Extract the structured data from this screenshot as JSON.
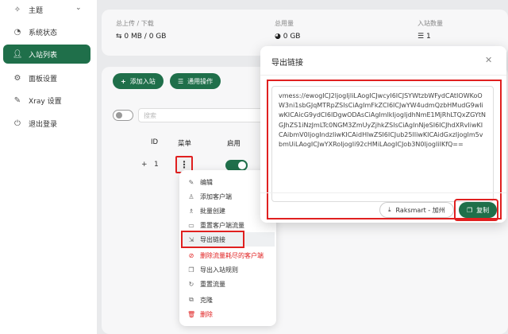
{
  "sidebar": {
    "items": [
      {
        "label": "主题",
        "icon": "bulb-icon"
      },
      {
        "label": "系统状态",
        "icon": "dashboard-icon"
      },
      {
        "label": "入站列表",
        "icon": "user-icon"
      },
      {
        "label": "面板设置",
        "icon": "gear-icon"
      },
      {
        "label": "Xray 设置",
        "icon": "wrench-icon"
      },
      {
        "label": "退出登录",
        "icon": "logout-icon"
      }
    ]
  },
  "stats": {
    "traffic_label": "总上传 / 下载",
    "traffic_value": "0 MB / 0 GB",
    "usage_label": "总用量",
    "usage_value": "0 GB",
    "inbound_label": "入站数量",
    "inbound_value": "1"
  },
  "toolbar": {
    "add_label": "添加入站",
    "general_label": "通用操作",
    "search_placeholder": "搜索"
  },
  "table": {
    "headers": [
      "ID",
      "菜单",
      "启用"
    ],
    "rows": [
      {
        "expand": "+",
        "id": "1",
        "menu": "⋮"
      }
    ]
  },
  "menu": {
    "items": [
      {
        "label": "编辑",
        "icon": "edit-icon"
      },
      {
        "label": "添加客户端",
        "icon": "user-add-icon"
      },
      {
        "label": "批量创建",
        "icon": "users-icon"
      },
      {
        "label": "重置客户端流量",
        "icon": "reset-icon"
      },
      {
        "label": "导出链接",
        "icon": "export-icon"
      },
      {
        "label": "删除流量耗尽的客户端",
        "icon": "delete-icon"
      },
      {
        "label": "导出入站规则",
        "icon": "copy-icon"
      },
      {
        "label": "重置流量",
        "icon": "reload-icon"
      },
      {
        "label": "克隆",
        "icon": "clone-icon"
      },
      {
        "label": "删除",
        "icon": "trash-icon"
      }
    ]
  },
  "modal": {
    "title": "导出链接",
    "link": "vmess://ewogICJ2IjogIjIiLAogICJwcyI6ICJSYWtzbWFydCAtIOWKoOW3ni1sbGJqMTRpZSIsCiAgImFkZCI6ICJwYW4udmQzbHMudG9wIiwKICAicG9ydCI6IDgwODAsCiAgImlkIjogIjdhNmE1MjRhLTQxZGYtNGJhZS1iNzJmLTc0NGM3ZmUyZjhkZSIsCiAgInNjeSI6ICJhdXRvIiwKICAibmV0IjogIndzIiwKICAidHlwZSI6ICJub25lIiwKICAidGxzIjogIm5vbmUiLAogICJwYXRoIjogIi92cHMiLAogICJob3N0IjogIiIKfQ==",
    "provider_label": "Raksmart - 加州",
    "copy_label": "复制"
  },
  "colors": {
    "accent": "#1f6f4a",
    "highlight_box": "#e02020"
  }
}
